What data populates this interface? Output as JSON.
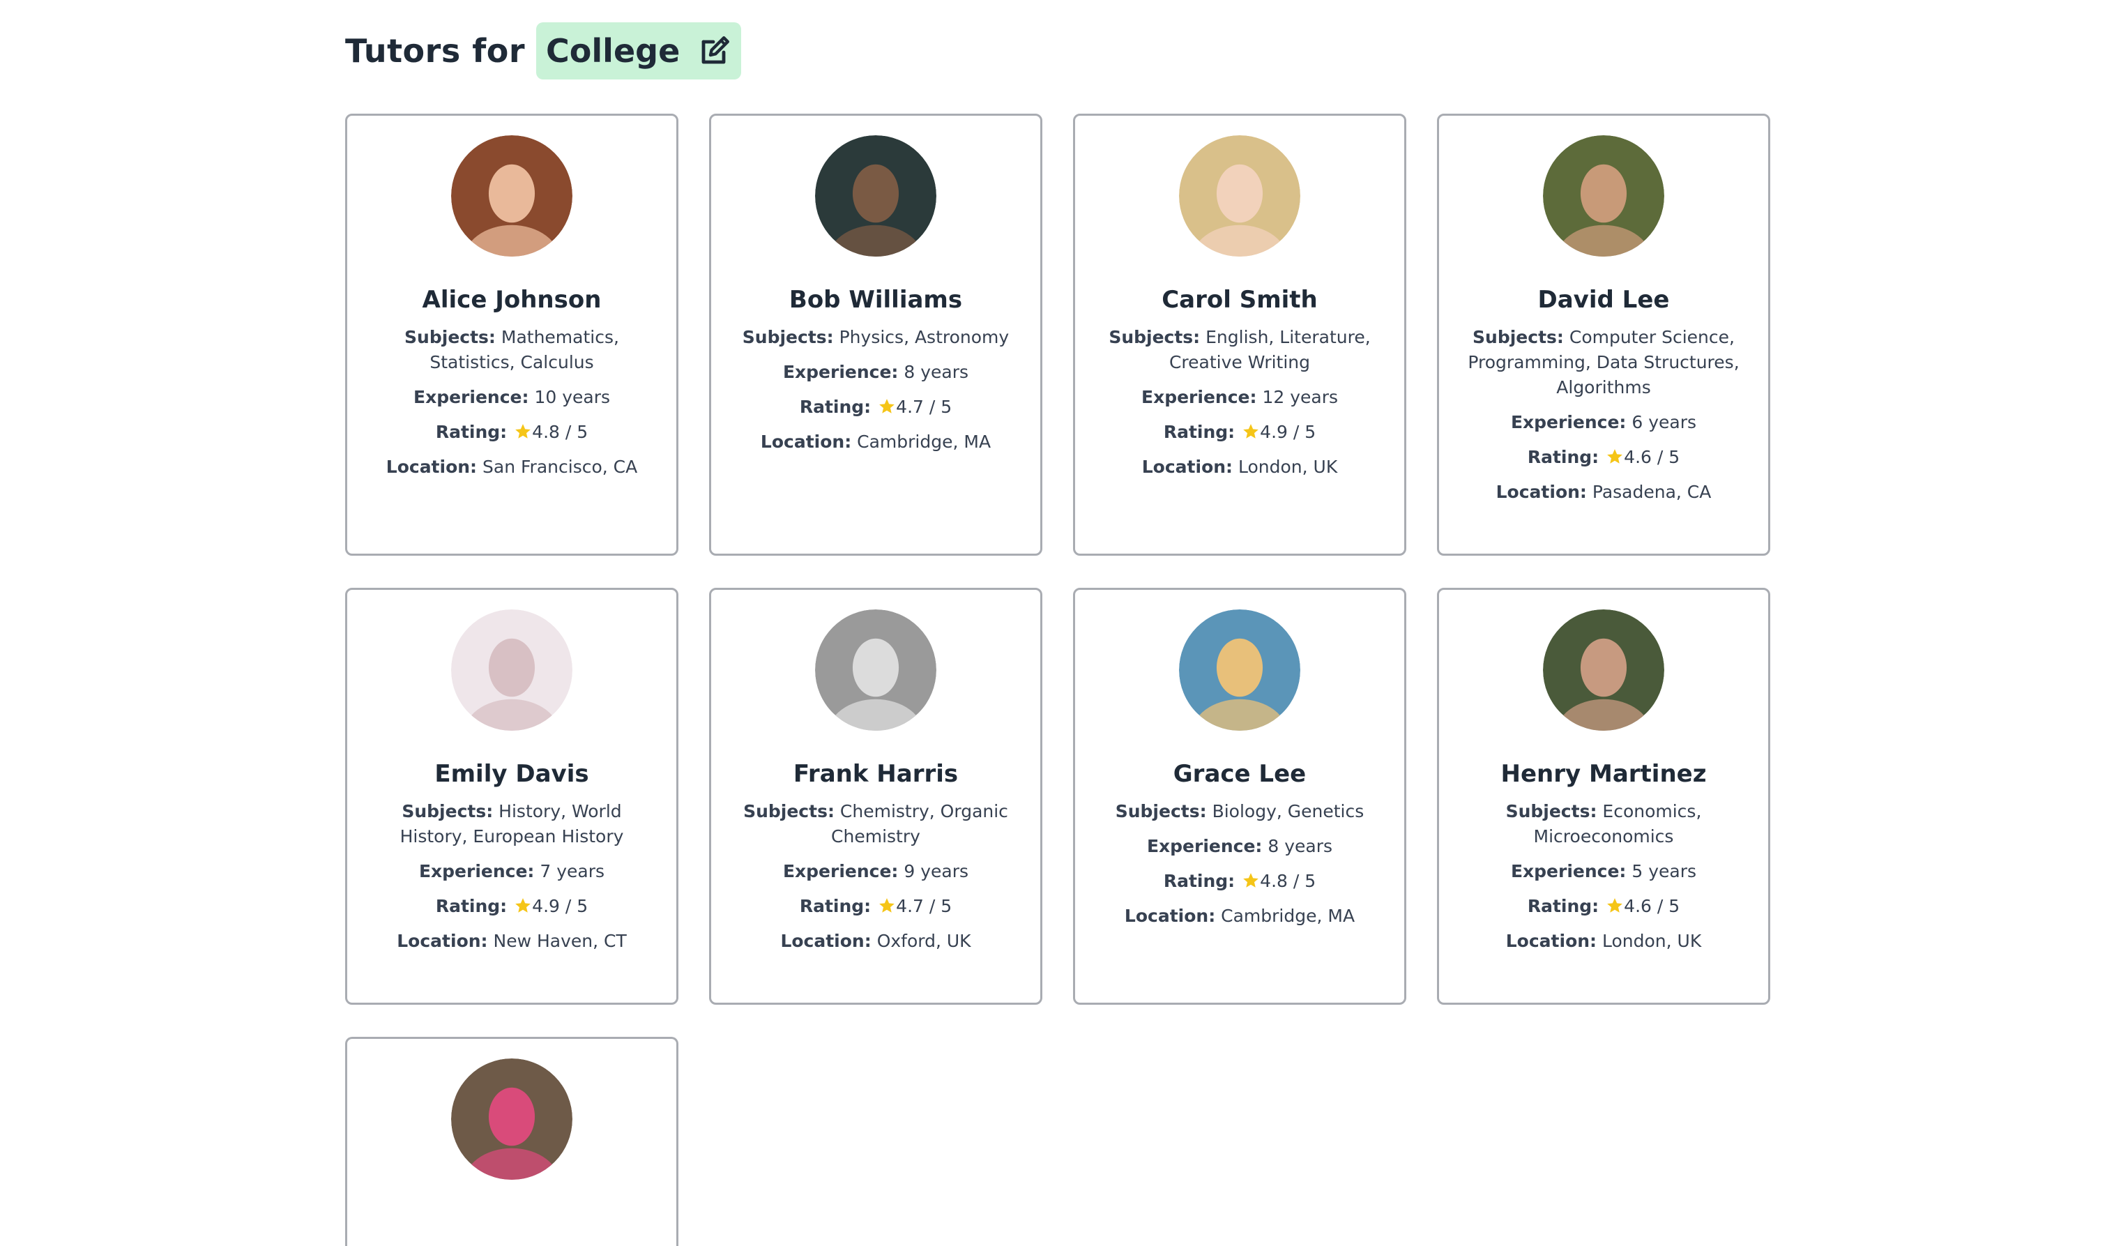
{
  "header": {
    "prefix": "Tutors for",
    "level": "College",
    "edit_icon": "edit-icon"
  },
  "labels": {
    "subjects": "Subjects:",
    "experience": "Experience:",
    "rating": "Rating:",
    "location": "Location:"
  },
  "colors": {
    "chip_bg": "#c9f2d7",
    "star": "#f5c518",
    "card_border": "#a9acb2"
  },
  "tutors": [
    {
      "name": "Alice Johnson",
      "subjects": "Mathematics, Statistics, Calculus",
      "experience": "10 years",
      "rating": "4.8 / 5",
      "location": "San Francisco, CA",
      "avatar_bg": "#8a4a2e",
      "avatar_fg": "#e9b99a"
    },
    {
      "name": "Bob Williams",
      "subjects": "Physics, Astronomy",
      "experience": "8 years",
      "rating": "4.7 / 5",
      "location": "Cambridge, MA",
      "avatar_bg": "#2b3a3a",
      "avatar_fg": "#7a5a44"
    },
    {
      "name": "Carol Smith",
      "subjects": "English, Literature, Creative Writing",
      "experience": "12 years",
      "rating": "4.9 / 5",
      "location": "London, UK",
      "avatar_bg": "#d9c08a",
      "avatar_fg": "#f2d2bb"
    },
    {
      "name": "David Lee",
      "subjects": "Computer Science, Programming, Data Structures, Algorithms",
      "experience": "6 years",
      "rating": "4.6 / 5",
      "location": "Pasadena, CA",
      "avatar_bg": "#5d6b3a",
      "avatar_fg": "#c89a78"
    },
    {
      "name": "Emily Davis",
      "subjects": "History, World History, European History",
      "experience": "7 years",
      "rating": "4.9 / 5",
      "location": "New Haven, CT",
      "avatar_bg": "#efe6ea",
      "avatar_fg": "#d8c0c4"
    },
    {
      "name": "Frank Harris",
      "subjects": "Chemistry, Organic Chemistry",
      "experience": "9 years",
      "rating": "4.7 / 5",
      "location": "Oxford, UK",
      "avatar_bg": "#9a9a9a",
      "avatar_fg": "#dcdcdc"
    },
    {
      "name": "Grace Lee",
      "subjects": "Biology, Genetics",
      "experience": "8 years",
      "rating": "4.8 / 5",
      "location": "Cambridge, MA",
      "avatar_bg": "#5b95b8",
      "avatar_fg": "#e8c07a"
    },
    {
      "name": "Henry Martinez",
      "subjects": "Economics, Microeconomics",
      "experience": "5 years",
      "rating": "4.6 / 5",
      "location": "London, UK",
      "avatar_bg": "#4a5a3a",
      "avatar_fg": "#c79a80"
    },
    {
      "name": "",
      "subjects": "",
      "experience": "",
      "rating": "",
      "location": "",
      "avatar_bg": "#6e5a48",
      "avatar_fg": "#d94b7a"
    }
  ]
}
